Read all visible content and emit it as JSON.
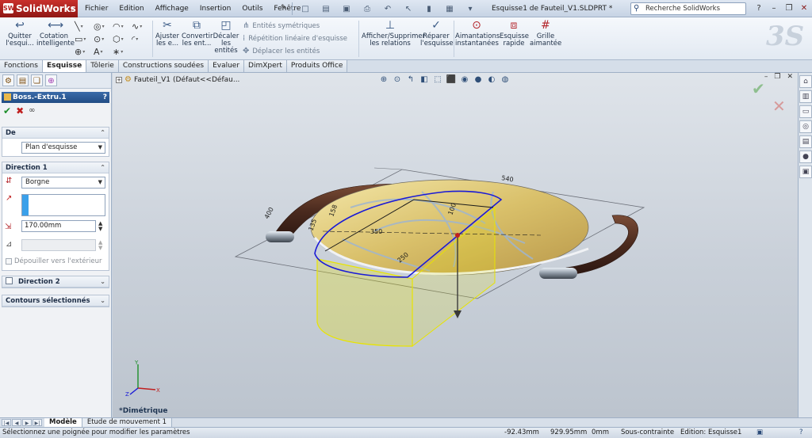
{
  "app": {
    "name": "SolidWorks",
    "logo_mark": "SW",
    "doc_title": "Esquisse1 de Fauteil_V1.SLDPRT *"
  },
  "menu": [
    "Fichier",
    "Edition",
    "Affichage",
    "Insertion",
    "Outils",
    "Fenêtre"
  ],
  "search": {
    "placeholder": "Recherche SolidWorks"
  },
  "ribbon": {
    "quit_sketch": "Quitter l'esqui...",
    "smart_dim": "Cotation intelligente",
    "trim": "Ajuster les e...",
    "convert": "Convertir les ent...",
    "offset": "Décaler les entités",
    "mirror": "Entités symétriques",
    "linear_pattern": "Répétition linéaire d'esquisse",
    "move": "Déplacer les entités",
    "relations": "Afficher/Supprimer les relations",
    "repair": "Réparer l'esquisse",
    "instant_snap": "Aimantations instantanées",
    "quick_snap": "Esquisse rapide",
    "grid": "Grille aimantée"
  },
  "tabs": [
    "Fonctions",
    "Esquisse",
    "Tôlerie",
    "Constructions soudées",
    "Evaluer",
    "DimXpert",
    "Produits Office"
  ],
  "active_tab": "Esquisse",
  "property_manager": {
    "title": "Boss.-Extru.1",
    "help": "?",
    "from_group": {
      "label": "De",
      "value": "Plan d'esquisse"
    },
    "direction1": {
      "label": "Direction 1",
      "end_condition": "Borgne",
      "depth": "170.00mm",
      "draft_label": "Dépouiller vers l'extérieur"
    },
    "direction2": {
      "label": "Direction 2"
    },
    "selected_contours": {
      "label": "Contours sélectionnés"
    }
  },
  "feature_tree": {
    "root": "Fauteil_V1",
    "config": "(Défaut<<Défau..."
  },
  "view_orientation": "*Dimétrique",
  "bottom_tabs": [
    "Modèle",
    "Etude de mouvement 1"
  ],
  "status": {
    "message": "Sélectionnez une poignée pour modifier les paramètres",
    "x": "-92.43mm",
    "y": "929.95mm",
    "z": "0mm",
    "constraint": "Sous-contrainte",
    "edition": "Edition: Esquisse1"
  },
  "dimensions": [
    "540",
    "400",
    "135",
    "158",
    "100",
    "350",
    "250"
  ],
  "colors": {
    "accent": "#224d85",
    "sketch_blue": "#1a1ad6",
    "preview_yellow": "#e8e400",
    "armrest": "#4a2a1e"
  },
  "icons": {
    "ok": "✔",
    "cancel": "✖",
    "preview": "∞"
  }
}
